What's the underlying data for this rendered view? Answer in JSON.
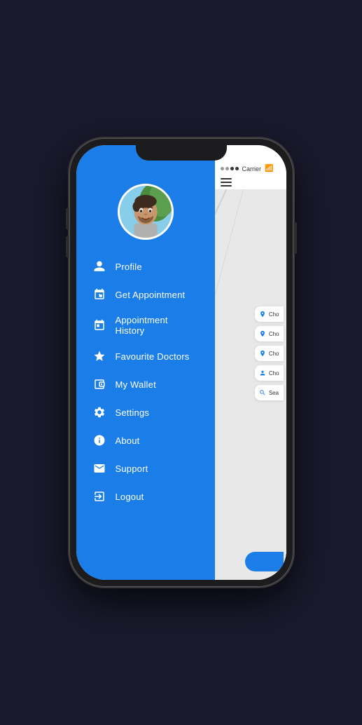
{
  "phone": {
    "status_bar": {
      "carrier": "Carrier",
      "wifi": "⌾",
      "dots": [
        "empty",
        "empty",
        "filled",
        "filled"
      ]
    },
    "hamburger_label": "☰"
  },
  "menu": {
    "items": [
      {
        "id": "profile",
        "label": "Profile",
        "icon": "person"
      },
      {
        "id": "get-appointment",
        "label": "Get Appointment",
        "icon": "calendar-add"
      },
      {
        "id": "appointment-history",
        "label": "Appointment History",
        "icon": "calendar-list"
      },
      {
        "id": "favourite-doctors",
        "label": "Favourite Doctors",
        "icon": "star"
      },
      {
        "id": "my-wallet",
        "label": "My Wallet",
        "icon": "wallet"
      },
      {
        "id": "settings",
        "label": "Settings",
        "icon": "gear"
      },
      {
        "id": "about",
        "label": "About",
        "icon": "info"
      },
      {
        "id": "support",
        "label": "Support",
        "icon": "envelope"
      },
      {
        "id": "logout",
        "label": "Logout",
        "icon": "logout"
      }
    ]
  },
  "right_panel": {
    "dropdown_items": [
      {
        "icon": "📍",
        "text": "Cho"
      },
      {
        "icon": "📍",
        "text": "Cho"
      },
      {
        "icon": "📍",
        "text": "Cho"
      },
      {
        "icon": "👤",
        "text": "Cho"
      },
      {
        "icon": "🔍",
        "text": "Sea"
      }
    ]
  }
}
